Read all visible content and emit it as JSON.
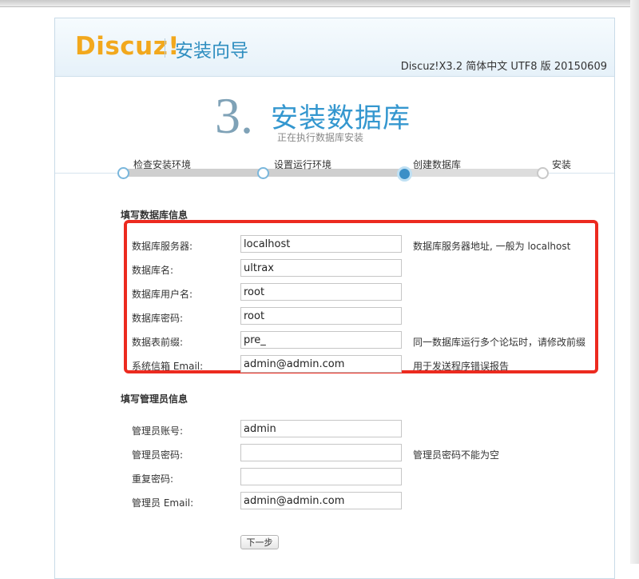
{
  "header": {
    "logo_text": "Discuz!",
    "wizard_title": "安装向导",
    "version": "Discuz!X3.2 简体中文 UTF8 版 20150609"
  },
  "step": {
    "number": "3.",
    "title": "安装数据库",
    "subtitle": "正在执行数据库安装"
  },
  "progress": {
    "current_step": 3,
    "steps": [
      {
        "label": "检查安装环境",
        "state": "done"
      },
      {
        "label": "设置运行环境",
        "state": "done"
      },
      {
        "label": "创建数据库",
        "state": "current"
      },
      {
        "label": "安装",
        "state": "pending"
      }
    ]
  },
  "db_section": {
    "title": "填写数据库信息",
    "fields": [
      {
        "label": "数据库服务器:",
        "value": "localhost",
        "hint": "数据库服务器地址, 一般为 localhost"
      },
      {
        "label": "数据库名:",
        "value": "ultrax",
        "hint": ""
      },
      {
        "label": "数据库用户名:",
        "value": "root",
        "hint": ""
      },
      {
        "label": "数据库密码:",
        "value": "root",
        "hint": ""
      },
      {
        "label": "数据表前缀:",
        "value": "pre_",
        "hint": "同一数据库运行多个论坛时，请修改前缀"
      },
      {
        "label": "系统信箱 Email:",
        "value": "admin@admin.com",
        "hint": "用于发送程序错误报告"
      }
    ]
  },
  "admin_section": {
    "title": "填写管理员信息",
    "fields": [
      {
        "label": "管理员账号:",
        "value": "admin",
        "hint": ""
      },
      {
        "label": "管理员密码:",
        "value": "",
        "hint": "管理员密码不能为空"
      },
      {
        "label": "重复密码:",
        "value": "",
        "hint": ""
      },
      {
        "label": "管理员 Email:",
        "value": "admin@admin.com",
        "hint": ""
      }
    ]
  },
  "next_button": "下一步",
  "colors": {
    "accent": "#3497cf",
    "logo": "#f2a81d",
    "highlight_box": "#ec2a1f"
  }
}
